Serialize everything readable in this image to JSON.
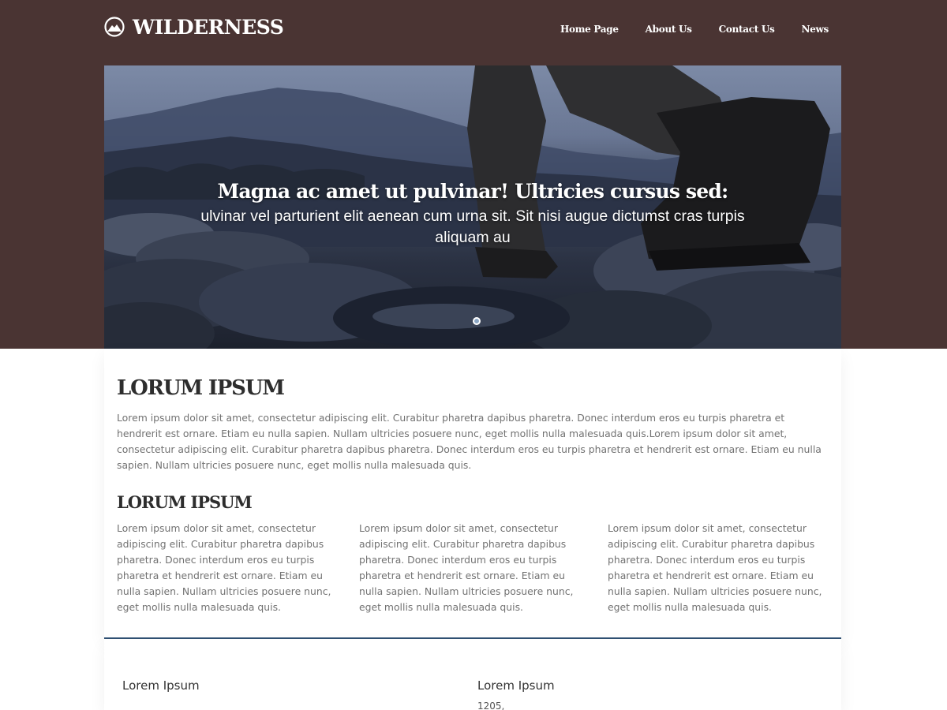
{
  "brand": {
    "name": "WILDERNESS",
    "logo_icon": "mountain-circle-icon"
  },
  "nav": {
    "items": [
      {
        "label": "Home Page"
      },
      {
        "label": "About Us"
      },
      {
        "label": "Contact Us"
      },
      {
        "label": "News"
      }
    ]
  },
  "hero": {
    "title": "Magna ac amet ut pulvinar! Ultricies cursus sed:",
    "subtitle": "ulvinar vel parturient elit aenean cum urna sit. Sit nisi augue dictumst cras turpis aliquam au"
  },
  "main": {
    "heading": "LORUM IPSUM",
    "intro": "Lorem ipsum dolor sit amet, consectetur adipiscing elit. Curabitur pharetra dapibus pharetra. Donec interdum eros eu turpis pharetra et hendrerit est ornare. Etiam eu nulla sapien. Nullam ultricies posuere nunc, eget mollis nulla malesuada quis.Lorem ipsum dolor sit amet, consectetur adipiscing elit. Curabitur pharetra dapibus pharetra. Donec interdum eros eu turpis pharetra et hendrerit est ornare. Etiam eu nulla sapien. Nullam ultricies posuere nunc, eget mollis nulla malesuada quis.",
    "subheading": "LORUM IPSUM",
    "columns": [
      "Lorem ipsum dolor sit amet, consectetur adipiscing elit. Curabitur pharetra dapibus pharetra. Donec interdum eros eu turpis pharetra et hendrerit est ornare. Etiam eu nulla sapien. Nullam ultricies posuere nunc, eget mollis nulla malesuada quis.",
      "Lorem ipsum dolor sit amet, consectetur adipiscing elit. Curabitur pharetra dapibus pharetra. Donec interdum eros eu turpis pharetra et hendrerit est ornare. Etiam eu nulla sapien. Nullam ultricies posuere nunc, eget mollis nulla malesuada quis.",
      "Lorem ipsum dolor sit amet, consectetur adipiscing elit. Curabitur pharetra dapibus pharetra. Donec interdum eros eu turpis pharetra et hendrerit est ornare. Etiam eu nulla sapien. Nullam ultricies posuere nunc, eget mollis nulla malesuada quis."
    ]
  },
  "footer": {
    "left_title": "Lorem Ipsum",
    "right_title": "Lorem Ipsum",
    "right_text": "1205,"
  },
  "colors": {
    "top_band": "#4a3433",
    "accent_border": "#2f5073",
    "heading": "#2d2d2d",
    "body_text": "#727272"
  }
}
